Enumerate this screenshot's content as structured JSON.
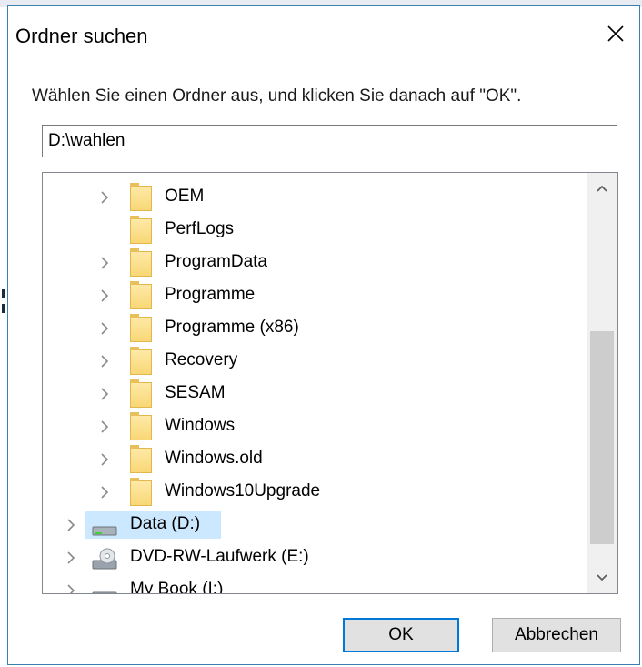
{
  "dialog": {
    "title": "Ordner suchen",
    "instruction": "Wählen Sie einen Ordner aus, und klicken Sie danach auf \"OK\".",
    "path_value": "D:\\wahlen"
  },
  "tree": {
    "folders": [
      {
        "label": "OEM",
        "expandable": true
      },
      {
        "label": "PerfLogs",
        "expandable": false
      },
      {
        "label": "ProgramData",
        "expandable": true
      },
      {
        "label": "Programme",
        "expandable": true
      },
      {
        "label": "Programme (x86)",
        "expandable": true
      },
      {
        "label": "Recovery",
        "expandable": true
      },
      {
        "label": "SESAM",
        "expandable": true
      },
      {
        "label": "Windows",
        "expandable": true
      },
      {
        "label": "Windows.old",
        "expandable": true
      },
      {
        "label": "Windows10Upgrade",
        "expandable": true
      }
    ],
    "drives": [
      {
        "label": "Data (D:)",
        "selected": true,
        "icon": "hard-drive-icon"
      },
      {
        "label": "DVD-RW-Laufwerk (E:)",
        "selected": false,
        "icon": "dvd-drive-icon"
      },
      {
        "label": "My Book (I:)",
        "selected": false,
        "icon": "hard-drive-icon"
      }
    ]
  },
  "buttons": {
    "ok": "OK",
    "cancel": "Abbrechen"
  },
  "colors": {
    "selection": "#cce8ff",
    "accent": "#0078d7",
    "folder": "#f8d775"
  }
}
